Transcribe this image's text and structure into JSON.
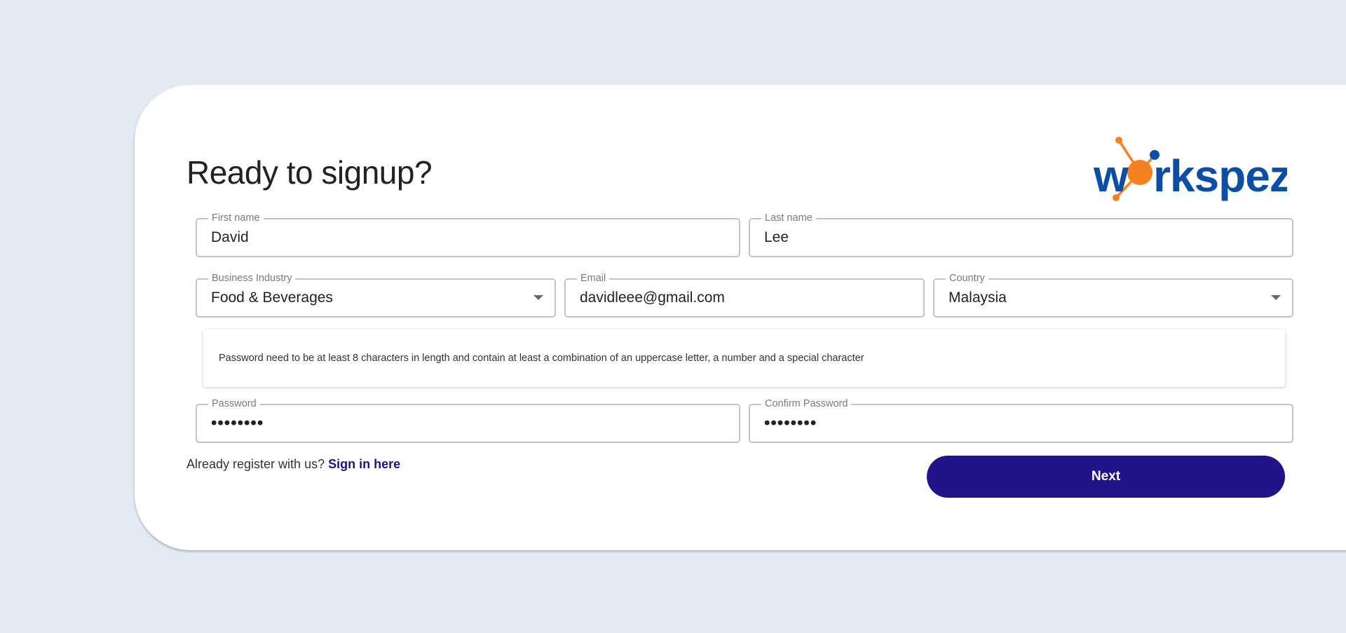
{
  "page": {
    "title": "Ready to signup?"
  },
  "logo": {
    "text": "workspez",
    "colors": {
      "primary": "#0a4ea6",
      "accent": "#f48120"
    }
  },
  "form": {
    "first_name": {
      "label": "First name",
      "value": "David"
    },
    "last_name": {
      "label": "Last name",
      "value": "Lee"
    },
    "business_industry": {
      "label": "Business Industry",
      "value": "Food & Beverages"
    },
    "email": {
      "label": "Email",
      "value": "davidleee@gmail.com"
    },
    "country": {
      "label": "Country",
      "value": "Malaysia"
    },
    "password_notice": "Password need to be at least 8 characters in length and contain at least a combination of an uppercase letter, a number and a special character",
    "password": {
      "label": "Password",
      "value": "••••••••"
    },
    "confirm_password": {
      "label": "Confirm Password",
      "value": "••••••••"
    }
  },
  "footer": {
    "signin_prompt": "Already register with us?",
    "signin_link": "Sign in here",
    "next_label": "Next"
  },
  "colors": {
    "background": "#e3eaf2",
    "button": "#201488",
    "link": "#1e1285"
  }
}
